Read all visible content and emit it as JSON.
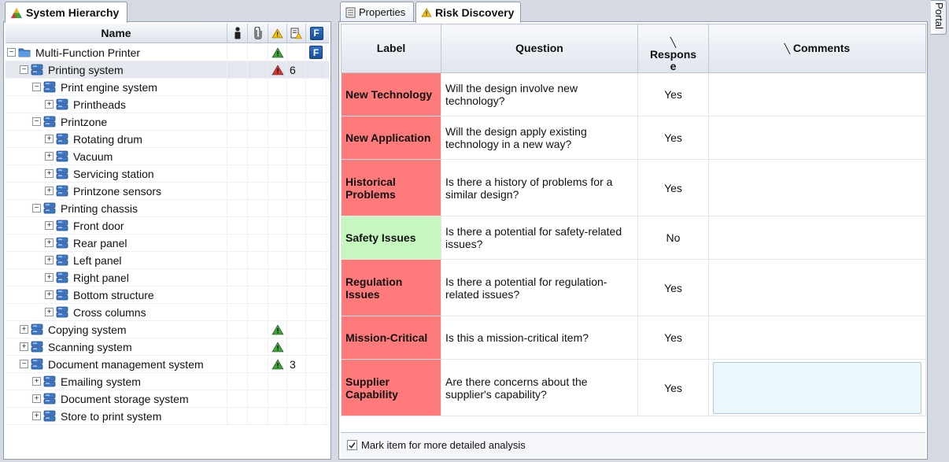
{
  "left_tab": {
    "title": "System Hierarchy"
  },
  "tree_header": {
    "name": "Name"
  },
  "tree": [
    {
      "label": "Multi-Function Printer",
      "level": 0,
      "exp": "minus",
      "icon": "folder",
      "warn": "green",
      "count": "",
      "f": true,
      "selected": false
    },
    {
      "label": "Printing system",
      "level": 1,
      "exp": "minus",
      "icon": "db",
      "warn": "red",
      "count": "6",
      "f": false,
      "selected": true
    },
    {
      "label": "Print engine system",
      "level": 2,
      "exp": "minus",
      "icon": "db",
      "warn": "",
      "count": "",
      "f": false
    },
    {
      "label": "Printheads",
      "level": 3,
      "exp": "plus",
      "icon": "db",
      "warn": "",
      "count": "",
      "f": false
    },
    {
      "label": "Printzone",
      "level": 2,
      "exp": "minus",
      "icon": "db",
      "warn": "",
      "count": "",
      "f": false
    },
    {
      "label": "Rotating drum",
      "level": 3,
      "exp": "plus",
      "icon": "db",
      "warn": "",
      "count": "",
      "f": false
    },
    {
      "label": "Vacuum",
      "level": 3,
      "exp": "plus",
      "icon": "db",
      "warn": "",
      "count": "",
      "f": false
    },
    {
      "label": "Servicing station",
      "level": 3,
      "exp": "plus",
      "icon": "db",
      "warn": "",
      "count": "",
      "f": false
    },
    {
      "label": "Printzone sensors",
      "level": 3,
      "exp": "plus",
      "icon": "db",
      "warn": "",
      "count": "",
      "f": false
    },
    {
      "label": "Printing chassis",
      "level": 2,
      "exp": "minus",
      "icon": "db",
      "warn": "",
      "count": "",
      "f": false
    },
    {
      "label": "Front door",
      "level": 3,
      "exp": "plus",
      "icon": "db",
      "warn": "",
      "count": "",
      "f": false
    },
    {
      "label": "Rear panel",
      "level": 3,
      "exp": "plus",
      "icon": "db",
      "warn": "",
      "count": "",
      "f": false
    },
    {
      "label": "Left panel",
      "level": 3,
      "exp": "plus",
      "icon": "db",
      "warn": "",
      "count": "",
      "f": false
    },
    {
      "label": "Right panel",
      "level": 3,
      "exp": "plus",
      "icon": "db",
      "warn": "",
      "count": "",
      "f": false
    },
    {
      "label": "Bottom structure",
      "level": 3,
      "exp": "plus",
      "icon": "db",
      "warn": "",
      "count": "",
      "f": false
    },
    {
      "label": "Cross columns",
      "level": 3,
      "exp": "plus",
      "icon": "db",
      "warn": "",
      "count": "",
      "f": false
    },
    {
      "label": "Copying system",
      "level": 1,
      "exp": "plus",
      "icon": "db",
      "warn": "green",
      "count": "",
      "f": false
    },
    {
      "label": "Scanning system",
      "level": 1,
      "exp": "plus",
      "icon": "db",
      "warn": "green",
      "count": "",
      "f": false
    },
    {
      "label": "Document management system",
      "level": 1,
      "exp": "minus",
      "icon": "db",
      "warn": "green",
      "count": "3",
      "f": false
    },
    {
      "label": "Emailing system",
      "level": 2,
      "exp": "plus",
      "icon": "db",
      "warn": "",
      "count": "",
      "f": false
    },
    {
      "label": "Document storage system",
      "level": 2,
      "exp": "plus",
      "icon": "db",
      "warn": "",
      "count": "",
      "f": false
    },
    {
      "label": "Store to print system",
      "level": 2,
      "exp": "plus",
      "icon": "db",
      "warn": "",
      "count": "",
      "f": false
    }
  ],
  "right_tabs": {
    "properties": "Properties",
    "risk": "Risk Discovery"
  },
  "grid": {
    "headers": {
      "label": "Label",
      "question": "Question",
      "response": "Respons\ne",
      "comments": "Comments"
    },
    "rows": [
      {
        "label": "New Technology",
        "question": "Will the design involve new technology?",
        "response": "Yes",
        "color": "red",
        "height": 55
      },
      {
        "label": "New Application",
        "question": "Will the design apply existing technology in a new way?",
        "response": "Yes",
        "color": "red",
        "height": 55
      },
      {
        "label": "Historical Problems",
        "question": "Is there a history of problems for a similar design?",
        "response": "Yes",
        "color": "red",
        "height": 72
      },
      {
        "label": "Safety Issues",
        "question": "Is there a potential for safety-related issues?",
        "response": "No",
        "color": "green",
        "height": 55
      },
      {
        "label": "Regulation Issues",
        "question": "Is there a potential for regulation-related issues?",
        "response": "Yes",
        "color": "red",
        "height": 72
      },
      {
        "label": "Mission-Critical",
        "question": "Is this a mission-critical item?",
        "response": "Yes",
        "color": "red",
        "height": 55
      },
      {
        "label": "Supplier Capability",
        "question": "Are there concerns about the supplier's capability?",
        "response": "Yes",
        "color": "red",
        "height": 72,
        "editing": true
      }
    ]
  },
  "footer": {
    "checkbox_label": "Mark item for more detailed analysis",
    "checked": true
  },
  "portal": {
    "label": "Portal"
  },
  "colors": {
    "red": "#ff7b7b",
    "green": "#c6f7be",
    "accent": "#2f73c9"
  }
}
